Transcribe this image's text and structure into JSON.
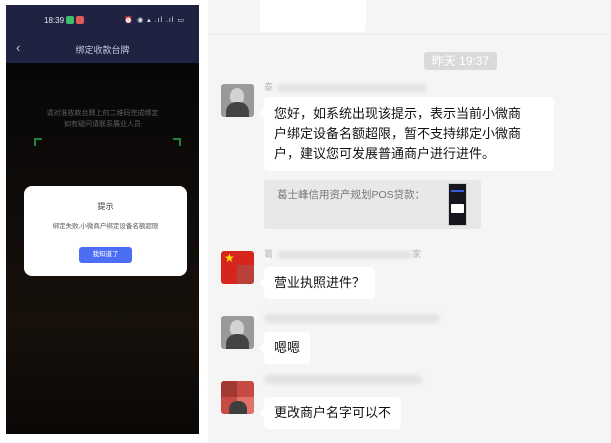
{
  "phone": {
    "status_time": "18:39",
    "status_icons": "⏰ ◉ ▴ .ıl .ıl ▭",
    "nav_back": "‹",
    "nav_title": "绑定收款台牌",
    "scan_hint_line1": "请对准收款台牌上的二维码完成绑定",
    "scan_hint_line2": "如有疑问请联系展业人员",
    "dialog": {
      "title": "提示",
      "message": "绑定失败,小微商户绑定设备名额超限",
      "button": "我知道了"
    }
  },
  "chat": {
    "timestamp": "昨天 19:37",
    "messages": [
      {
        "sender_visible": "泰",
        "lines": [
          "您好，如系统出现该提示，表示当前小微商",
          "户绑定设备名额超限，暂不支持绑定小微商",
          "户，建议您可发展普通商户进行进件。"
        ]
      },
      {
        "quote": "葛士峰信用资产规划POS贷款："
      },
      {
        "sender_visible": "葛",
        "sender_tail": "家",
        "text": "营业执照进件？"
      },
      {
        "text": "嗯嗯"
      },
      {
        "text": "更改商户名字可以不"
      }
    ]
  },
  "colors": {
    "phone_header": "#1f2341",
    "dialog_button": "#4c6ef5",
    "scan_corner": "#2ecc5a",
    "chat_background": "#f5f5f5",
    "timestamp_background": "#dadada"
  }
}
